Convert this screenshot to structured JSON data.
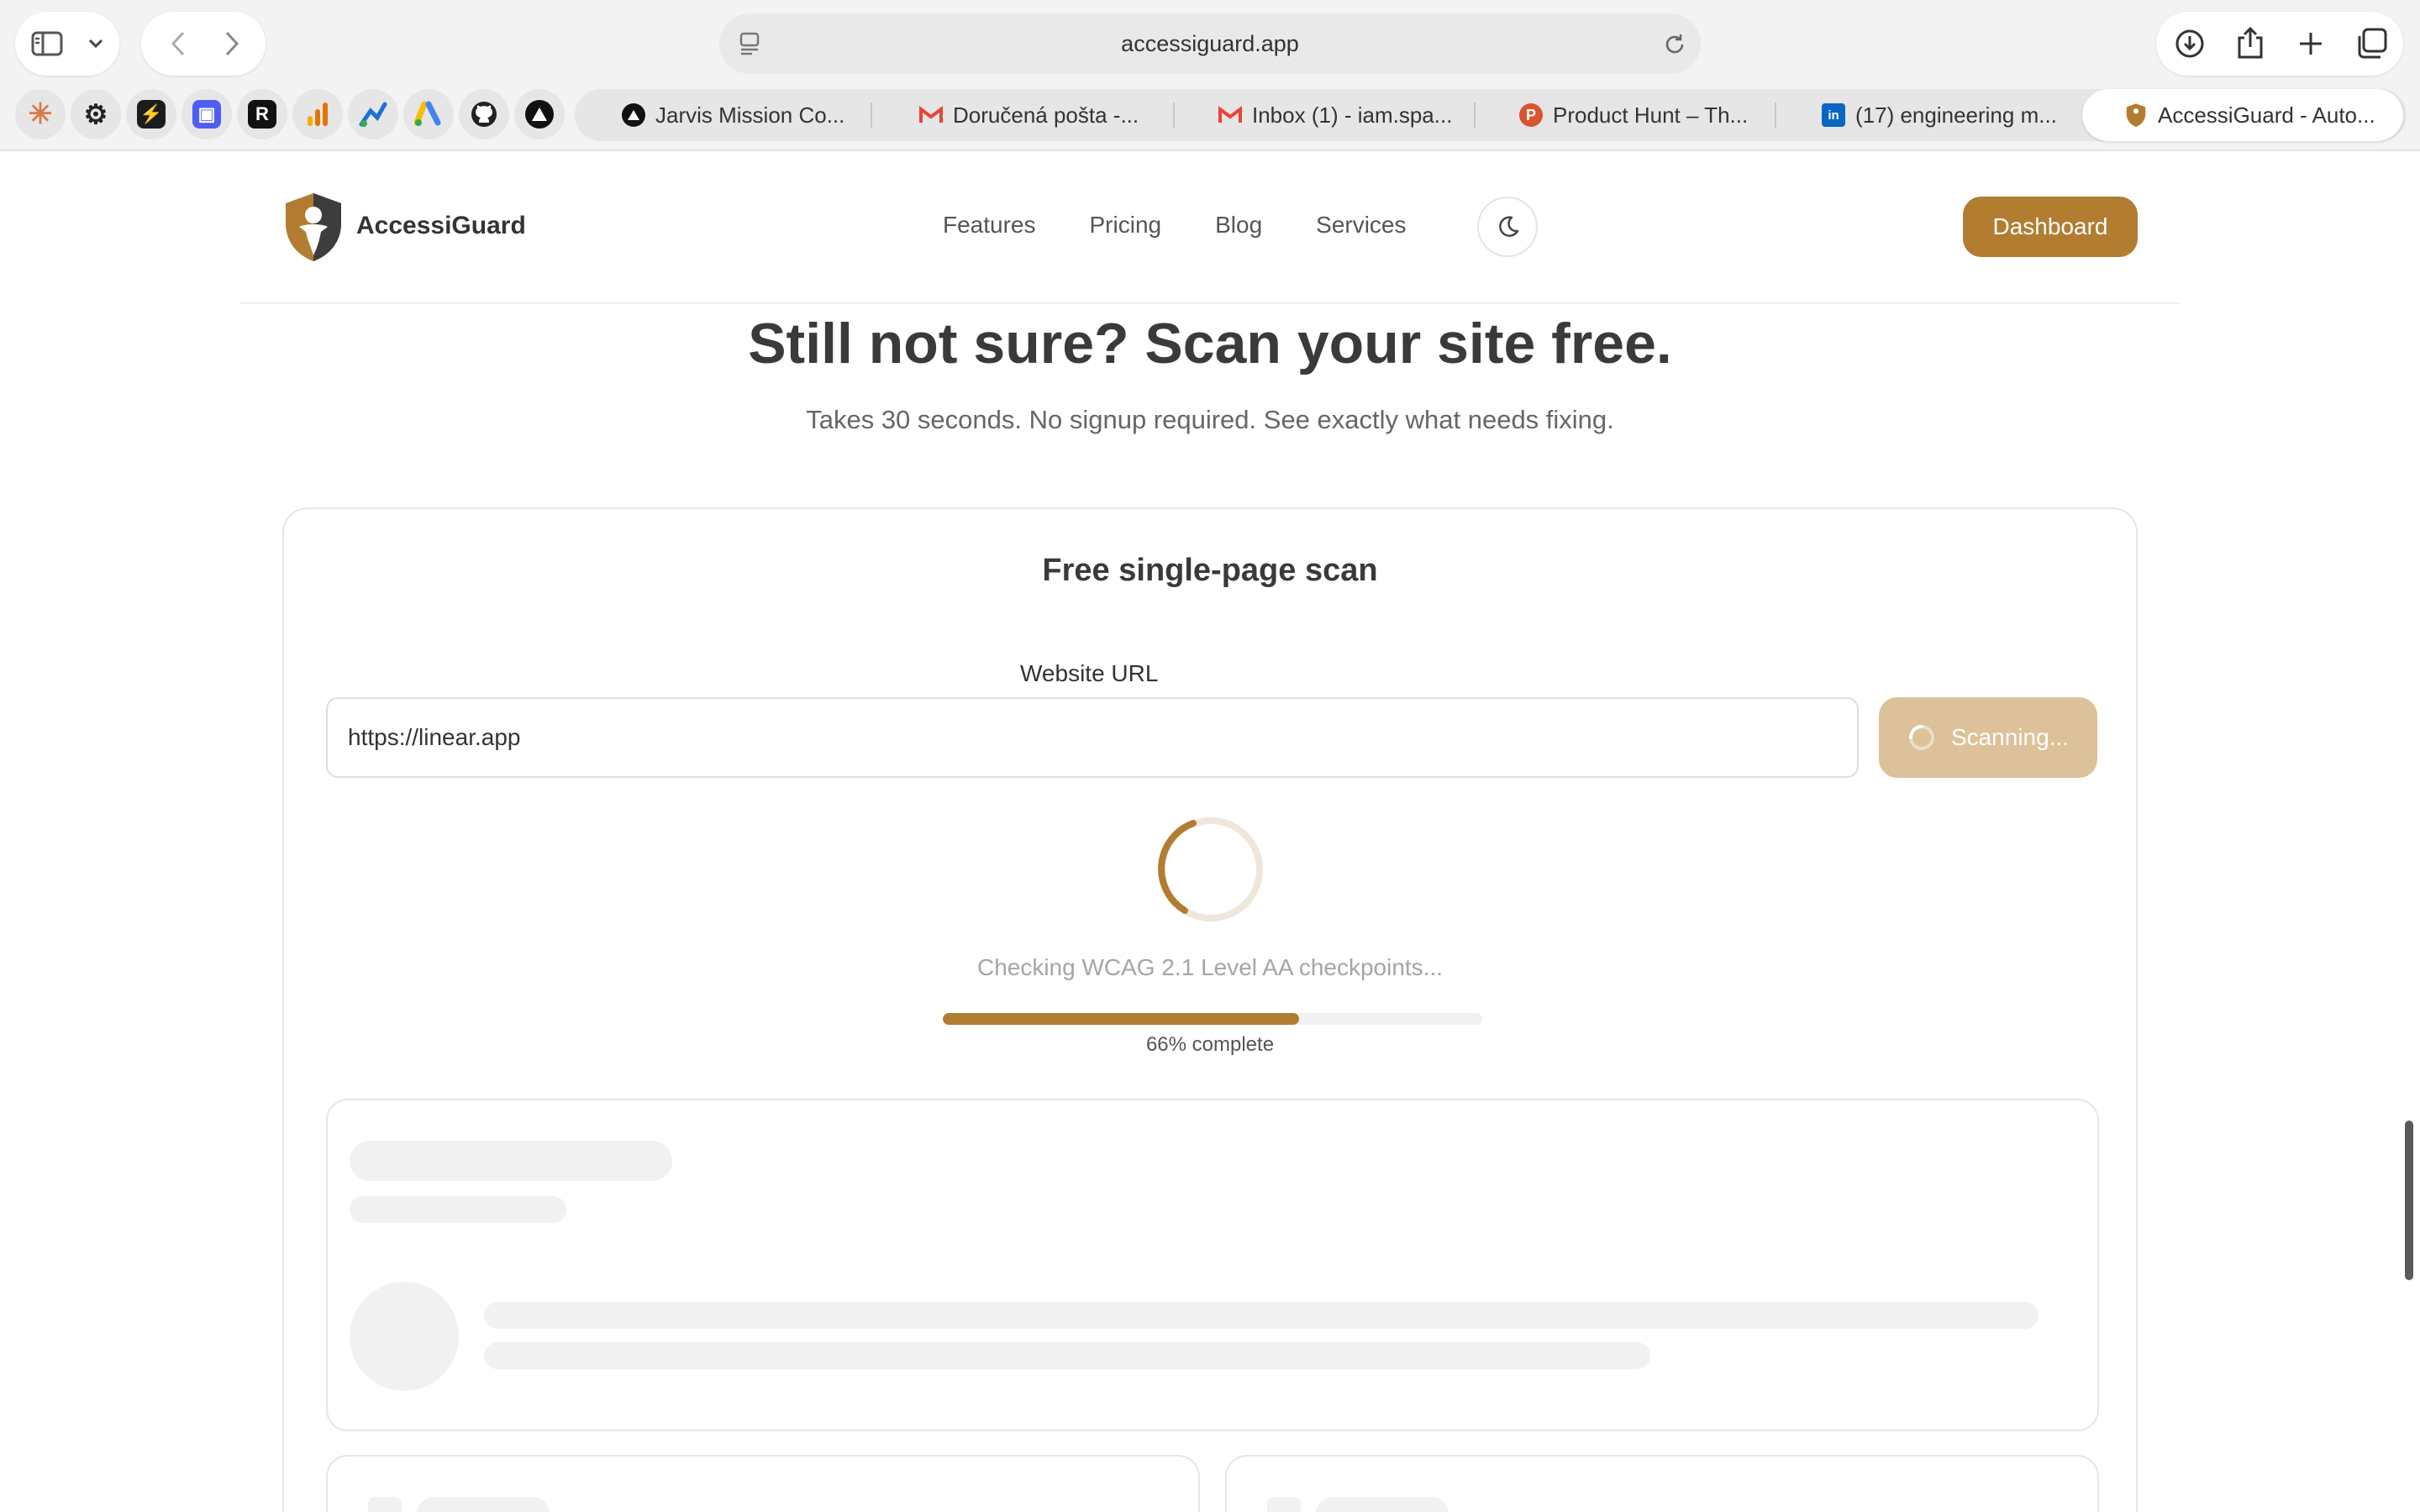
{
  "browser": {
    "address": "accessiguard.app",
    "tabs": [
      {
        "label": "Jarvis Mission Co...",
        "icon": "triangle-icon"
      },
      {
        "label": "Doručená pošta -...",
        "icon": "gmail-icon"
      },
      {
        "label": "Inbox (1) - iam.spa...",
        "icon": "gmail-icon"
      },
      {
        "label": "Product Hunt – Th...",
        "icon": "product-hunt-icon",
        "letter": "P"
      },
      {
        "label": "(17) engineering m...",
        "icon": "linkedin-icon",
        "letter": "in"
      },
      {
        "label": "AccessiGuard - Auto...",
        "icon": "accessiguard-icon"
      }
    ]
  },
  "site": {
    "brand": "AccessiGuard",
    "nav": [
      "Features",
      "Pricing",
      "Blog",
      "Services"
    ],
    "dashboard_label": "Dashboard",
    "accent_color": "#b27c31"
  },
  "hero": {
    "title": "Still not sure? Scan your site free.",
    "subtitle": "Takes 30 seconds. No signup required. See exactly what needs fixing."
  },
  "scan": {
    "card_title": "Free single-page scan",
    "url_label": "Website URL",
    "url_value": "https://linear.app",
    "button_label": "Scanning...",
    "status": "Checking WCAG 2.1 Level AA checkpoints...",
    "progress_percent": 66,
    "progress_text": "66% complete"
  }
}
